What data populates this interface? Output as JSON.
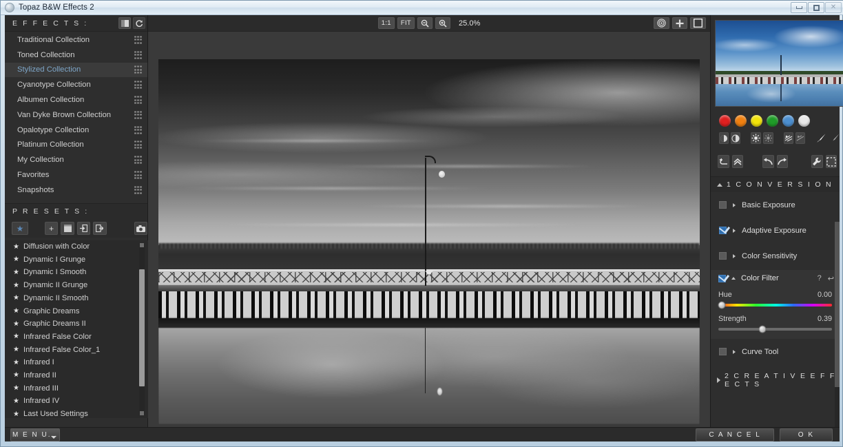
{
  "window": {
    "title": "Topaz B&W Effects 2",
    "app_icon": "app-logo-icon",
    "minimize": "−",
    "maximize": "□",
    "close": "×"
  },
  "effects_panel": {
    "header": "E F F E C T S :",
    "header_buttons": [
      {
        "name": "split-view-icon",
        "glyph": "▣"
      },
      {
        "name": "refresh-icon",
        "glyph": "⟳"
      }
    ],
    "collections": [
      {
        "label": "Traditional Collection",
        "active": false
      },
      {
        "label": "Toned Collection",
        "active": false
      },
      {
        "label": "Stylized Collection",
        "active": true
      },
      {
        "label": "Cyanotype Collection",
        "active": false
      },
      {
        "label": "Albumen Collection",
        "active": false
      },
      {
        "label": "Van Dyke Brown Collection",
        "active": false
      },
      {
        "label": "Opalotype Collection",
        "active": false
      },
      {
        "label": "Platinum Collection",
        "active": false
      },
      {
        "label": "My Collection",
        "active": false
      },
      {
        "label": "Favorites",
        "active": false
      },
      {
        "label": "Snapshots",
        "active": false
      }
    ]
  },
  "presets_panel": {
    "header": "P R E S E T S :",
    "tools": [
      {
        "name": "favorite-star-button",
        "glyph": "★"
      },
      {
        "name": "add-preset-button",
        "glyph": "+"
      },
      {
        "name": "delete-preset-button",
        "glyph": "▤"
      },
      {
        "name": "import-preset-button",
        "glyph": "⊒"
      },
      {
        "name": "export-preset-button",
        "glyph": "⊐"
      },
      {
        "name": "snapshot-camera-button",
        "glyph": "▣"
      }
    ],
    "star": "★",
    "items": [
      "Diffusion with Color",
      "Dynamic I Grunge",
      "Dynamic I Smooth",
      "Dynamic II Grunge",
      "Dynamic II Smooth",
      "Graphic Dreams",
      "Graphic Dreams II",
      "Infrared False Color",
      "Infrared False Color_1",
      "Infrared I",
      "Infrared II",
      "Infrared III",
      "Infrared IV",
      "Last Used Settings"
    ]
  },
  "toolbar": {
    "one_to_one": "1:1",
    "fit": "FIT",
    "zoom_out_icon": "⊖",
    "zoom_in_icon": "⊕",
    "zoom_level": "25.0%",
    "right_icons": [
      {
        "name": "target-icon",
        "glyph": "◎"
      },
      {
        "name": "pan-move-icon",
        "glyph": "✛"
      },
      {
        "name": "preview-toggle-icon",
        "glyph": "▢"
      }
    ]
  },
  "navigator": {
    "name": "navigator-thumbnail",
    "description": "Color preview of original pier photograph"
  },
  "color_swatches": [
    {
      "name": "swatch-red",
      "color": "#e02020"
    },
    {
      "name": "swatch-orange",
      "color": "#f08010"
    },
    {
      "name": "swatch-yellow",
      "color": "#f2e30a"
    },
    {
      "name": "swatch-green",
      "color": "#1f9c28"
    },
    {
      "name": "swatch-blue",
      "color": "#4c8fd0"
    },
    {
      "name": "swatch-white",
      "color": "#e8e8e8"
    }
  ],
  "tool_icons": [
    {
      "name": "burn-icon",
      "glyph": "◑"
    },
    {
      "name": "dodge-icon",
      "glyph": "◐"
    },
    {
      "name": "brightness-up-icon",
      "glyph": "☀"
    },
    {
      "name": "brightness-down-icon",
      "glyph": "☼"
    },
    {
      "name": "detail-up-icon",
      "glyph": "✥"
    },
    {
      "name": "detail-down-icon",
      "glyph": "✢"
    },
    {
      "name": "brush-icon",
      "glyph": "✎"
    },
    {
      "name": "erase-brush-icon",
      "glyph": "✐"
    }
  ],
  "history_icons": [
    {
      "name": "undo-history-icon",
      "glyph": "↰"
    },
    {
      "name": "collapse-all-icon",
      "glyph": "⌃"
    },
    {
      "name": "undo-icon",
      "glyph": "↩"
    },
    {
      "name": "redo-icon",
      "glyph": "↪"
    },
    {
      "name": "settings-wrench-icon",
      "glyph": "🔧"
    },
    {
      "name": "selection-icon",
      "glyph": "⬚"
    }
  ],
  "adjustments": {
    "section1": {
      "title": "1  C O N V E R S I O N",
      "expanded": true,
      "rows": [
        {
          "label": "Basic Exposure",
          "checked": false,
          "expanded": false
        },
        {
          "label": "Adaptive Exposure",
          "checked": true,
          "expanded": false
        },
        {
          "label": "Color Sensitivity",
          "checked": false,
          "expanded": false
        }
      ]
    },
    "color_filter": {
      "label": "Color Filter",
      "checked": true,
      "expanded": true,
      "help_icon": "?",
      "reset_icon": "↩",
      "sliders": [
        {
          "name": "hue",
          "label": "Hue",
          "value": "0.00",
          "position_pct": 3,
          "gradient": "hue"
        },
        {
          "name": "strength",
          "label": "Strength",
          "value": "0.39",
          "position_pct": 39,
          "gradient": "plain"
        }
      ]
    },
    "curve_tool": {
      "label": "Curve Tool",
      "checked": false,
      "expanded": false
    },
    "section2": {
      "title": "2  C R E A T I V E   E F F E C T S",
      "expanded": false
    }
  },
  "bottom": {
    "menu": "M E N U...",
    "cancel": "C A N C E L",
    "ok": "O K"
  }
}
